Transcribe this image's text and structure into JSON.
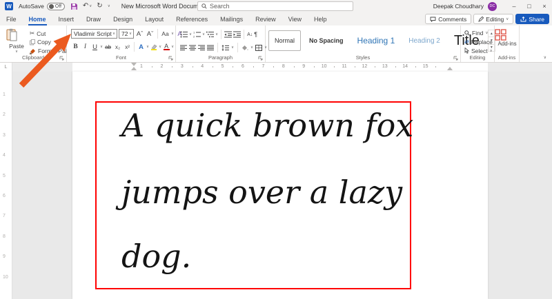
{
  "titlebar": {
    "autosave_label": "AutoSave",
    "autosave_state": "Off",
    "document_title": "New Microsoft Word Document",
    "search_placeholder": "Search",
    "user_name": "Deepak Choudhary",
    "user_initials": "DC"
  },
  "tabs": [
    {
      "label": "File"
    },
    {
      "label": "Home"
    },
    {
      "label": "Insert"
    },
    {
      "label": "Draw"
    },
    {
      "label": "Design"
    },
    {
      "label": "Layout"
    },
    {
      "label": "References"
    },
    {
      "label": "Mailings"
    },
    {
      "label": "Review"
    },
    {
      "label": "View"
    },
    {
      "label": "Help"
    }
  ],
  "actions": {
    "comments": "Comments",
    "editing": "Editing",
    "share": "Share"
  },
  "clipboard": {
    "paste": "Paste",
    "cut": "Cut",
    "copy": "Copy",
    "format_painter": "Format Painter",
    "group_label": "Clipboard"
  },
  "font": {
    "font_name": "Vladimir Script",
    "font_size": "72",
    "group_label": "Font"
  },
  "paragraph": {
    "group_label": "Paragraph"
  },
  "styles": {
    "items": [
      "Normal",
      "No Spacing",
      "Heading 1",
      "Heading 2",
      "Title"
    ],
    "group_label": "Styles"
  },
  "editing_group": {
    "find": "Find",
    "replace": "Replace",
    "select": "Select",
    "group_label": "Editing"
  },
  "addins": {
    "button_label": "Add-ins",
    "group_label": "Add-ins"
  },
  "ruler": {
    "h_numbers": [
      "1",
      "2",
      "3",
      "4",
      "5",
      "6",
      "7",
      "8",
      "9",
      "10",
      "11",
      "12",
      "13",
      "14",
      "15"
    ],
    "v_numbers": [
      "1",
      "2",
      "3",
      "4",
      "5",
      "6",
      "7",
      "8",
      "9",
      "10"
    ]
  },
  "document": {
    "lines": [
      "A quick brown fox",
      "jumps over a lazy",
      "dog."
    ],
    "border_color": "#FF0000"
  },
  "glyphs": {
    "word_logo": "W",
    "chevron_down": "∨",
    "undo": "↶",
    "redo": "↻",
    "minimize": "–",
    "maximize": "□",
    "close": "×",
    "scissors": "✂",
    "pilcrow": "¶",
    "sort": "A↓",
    "grow_font": "Aˆ",
    "shrink_font": "Aˇ",
    "change_case": "Aa",
    "clear_format": "A",
    "bold": "B",
    "italic": "I",
    "underline": "U",
    "strikethrough": "ab",
    "subscript": "x₂",
    "superscript": "x²",
    "text_effects": "A",
    "font_color": "A",
    "replace_arrows": "⇄",
    "tab_selector": "L"
  },
  "colors": {
    "accent_blue": "#185ABD",
    "arrow_orange": "#EB5A1F",
    "red_border": "#FF0000",
    "avatar_purple": "#8A2DA5",
    "save_purple": "#9B3FA8"
  }
}
